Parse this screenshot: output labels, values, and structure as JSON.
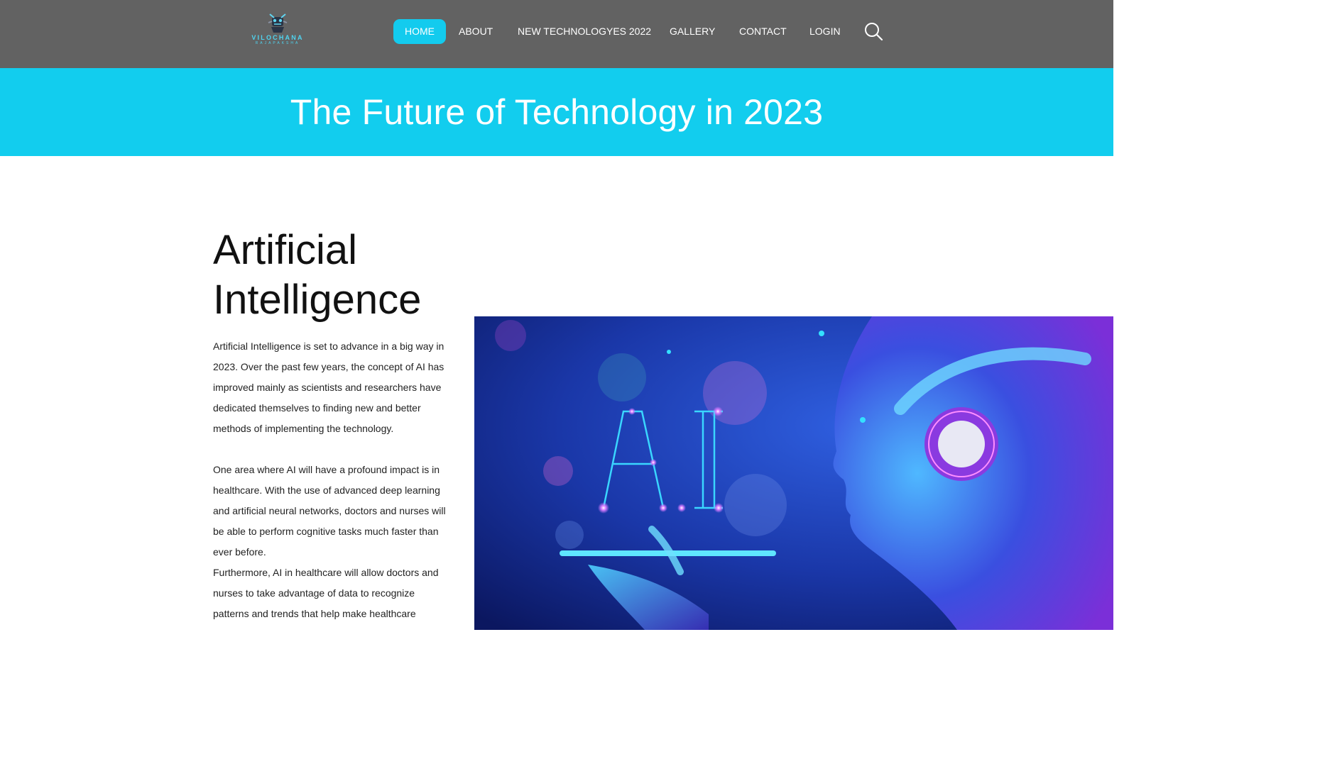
{
  "brand": {
    "name": "VILOCHANA",
    "sub": "RAJAPAKSHA"
  },
  "nav": {
    "items": [
      {
        "label": "HOME",
        "active": true
      },
      {
        "label": "ABOUT"
      },
      {
        "label": "NEW TECHNOLOGYES 2022"
      },
      {
        "label": "GALLERY"
      },
      {
        "label": "CONTACT"
      },
      {
        "label": "LOGIN"
      }
    ],
    "search_icon": "search-icon"
  },
  "hero": {
    "title": "The Future of Technology in 2023"
  },
  "section": {
    "title": "Artificial Intelligence",
    "paragraphs": [
      "Artificial Intelligence is set to advance in a big way in 2023. Over the past few years, the concept of AI has improved mainly as scientists and researchers have dedicated themselves to finding new and better methods of implementing the technology.",
      "One area where AI will have a profound impact is in healthcare. With the use of advanced deep learning and artificial neural networks, doctors and nurses will be able to perform cognitive tasks much faster than ever before.",
      "Furthermore, AI in healthcare will allow doctors and nurses to take advantage of data to recognize patterns and trends that help make healthcare"
    ],
    "image_text": "AI"
  },
  "colors": {
    "nav_bg": "#626262",
    "accent": "#12cdee",
    "text": "#222222"
  }
}
